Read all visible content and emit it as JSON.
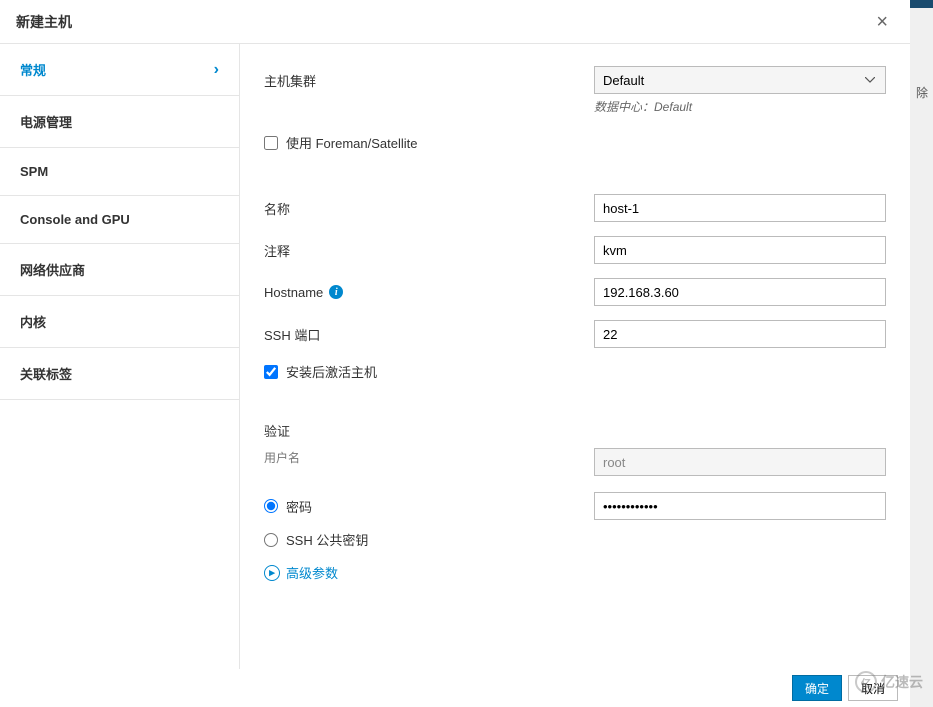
{
  "dialog": {
    "title": "新建主机"
  },
  "sidebar": {
    "items": [
      {
        "label": "常规",
        "active": true
      },
      {
        "label": "电源管理",
        "active": false
      },
      {
        "label": "SPM",
        "active": false
      },
      {
        "label": "Console and GPU",
        "active": false
      },
      {
        "label": "网络供应商",
        "active": false
      },
      {
        "label": "内核",
        "active": false
      },
      {
        "label": "关联标签",
        "active": false
      }
    ]
  },
  "form": {
    "cluster": {
      "label": "主机集群",
      "value": "Default",
      "sub_prefix": "数据中心：",
      "sub_value": "Default"
    },
    "foreman": {
      "label": "使用 Foreman/Satellite",
      "checked": false
    },
    "name": {
      "label": "名称",
      "value": "host-1"
    },
    "comment": {
      "label": "注释",
      "value": "kvm"
    },
    "hostname": {
      "label": "Hostname",
      "value": "192.168.3.60"
    },
    "ssh_port": {
      "label": "SSH 端口",
      "value": "22"
    },
    "activate": {
      "label": "安装后激活主机",
      "checked": true
    },
    "auth": {
      "section_label": "验证",
      "username_label": "用户名",
      "username_value": "root",
      "password_option": "密码",
      "password_value": "••••••••••••",
      "ssh_key_option": "SSH 公共密钥",
      "selected": "password",
      "advanced_label": "高级参数"
    }
  },
  "footer": {
    "ok": "确定",
    "cancel": "取消"
  },
  "bgstrip": {
    "char": "除"
  },
  "watermark": {
    "text": "亿速云"
  }
}
